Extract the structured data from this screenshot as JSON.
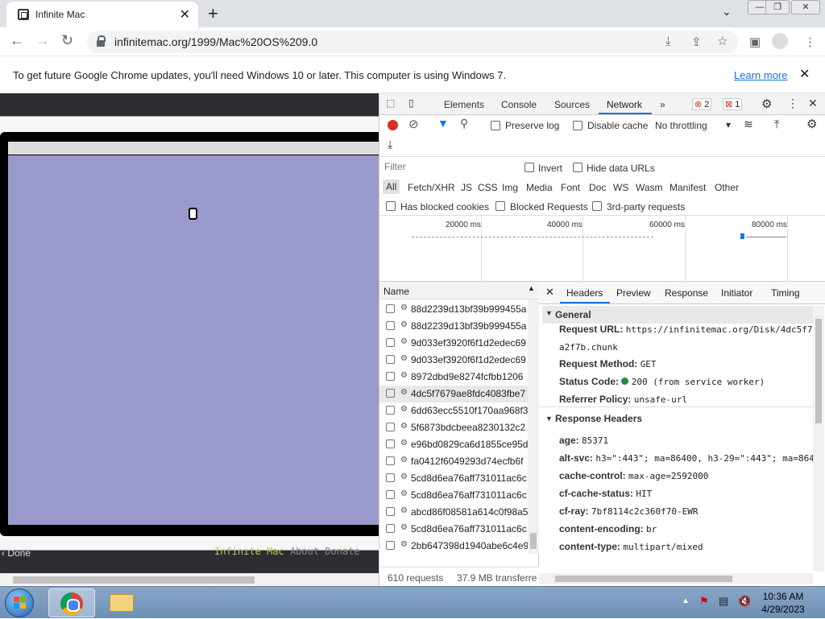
{
  "browser": {
    "tab_title": "Infinite Mac",
    "url": "infinitemac.org/1999/Mac%20OS%209.0"
  },
  "infobar": {
    "message": "To get future Google Chrome updates, you'll need Windows 10 or later. This computer is using Windows 7.",
    "link": "Learn more"
  },
  "page": {
    "status": "‹ Done",
    "footer_links": [
      "Infinite Mac",
      "About",
      "Donate"
    ]
  },
  "devtools": {
    "tabs": [
      "Elements",
      "Console",
      "Sources",
      "Network"
    ],
    "active_tab": "Network",
    "error_count": "2",
    "issue_count": "1",
    "toolbar": {
      "preserve_log": "Preserve log",
      "disable_cache": "Disable cache",
      "throttling": "No throttling"
    },
    "filter": {
      "placeholder": "Filter",
      "invert": "Invert",
      "hide_data_urls": "Hide data URLs",
      "types": [
        "All",
        "Fetch/XHR",
        "JS",
        "CSS",
        "Img",
        "Media",
        "Font",
        "Doc",
        "WS",
        "Wasm",
        "Manifest",
        "Other"
      ],
      "has_blocked_cookies": "Has blocked cookies",
      "blocked_requests": "Blocked Requests",
      "third_party": "3rd-party requests"
    },
    "timeline_ticks": [
      "20000 ms",
      "40000 ms",
      "60000 ms",
      "80000 ms"
    ],
    "requests": {
      "column": "Name",
      "rows": [
        "88d2239d13bf39b999455a",
        "88d2239d13bf39b999455a",
        "9d033ef3920f6f1d2edec69",
        "9d033ef3920f6f1d2edec69",
        "8972dbd9e8274fcfbb1206",
        "4dc5f7679ae8fdc4083fbe7",
        "6dd63ecc5510f170aa968f3",
        "5f6873bdcbeea8230132c2",
        "e96bd0829ca6d1855ce95d",
        "fa0412f6049293d74ecfb6f",
        "5cd8d6ea76aff731011ac6c",
        "5cd8d6ea76aff731011ac6c",
        "abcd86f08581a614c0f98a5",
        "5cd8d6ea76aff731011ac6c",
        "2bb647398d1940abe6c4e9"
      ],
      "selected_index": 5,
      "count": "610 requests",
      "transferred": "37.9 MB transferre"
    },
    "details": {
      "tabs": [
        "Headers",
        "Preview",
        "Response",
        "Initiator",
        "Timing"
      ],
      "active": "Headers",
      "general_title": "General",
      "general": [
        {
          "k": "Request URL:",
          "v": "https://infinitemac.org/Disk/4dc5f7"
        },
        {
          "k": "",
          "v": "a2f7b.chunk"
        },
        {
          "k": "Request Method:",
          "v": "GET"
        },
        {
          "k": "Status Code:",
          "v": "200  (from service worker)"
        },
        {
          "k": "Referrer Policy:",
          "v": "unsafe-url"
        }
      ],
      "response_title": "Response Headers",
      "response": [
        {
          "k": "age:",
          "v": "85371"
        },
        {
          "k": "alt-svc:",
          "v": "h3=\":443\"; ma=86400, h3-29=\":443\"; ma=864"
        },
        {
          "k": "cache-control:",
          "v": "max-age=2592000"
        },
        {
          "k": "cf-cache-status:",
          "v": "HIT"
        },
        {
          "k": "cf-ray:",
          "v": "7bf8114c2c360f70-EWR"
        },
        {
          "k": "content-encoding:",
          "v": "br"
        },
        {
          "k": "content-type:",
          "v": "multipart/mixed"
        }
      ],
      "status_color": "#1e8e3e"
    }
  },
  "taskbar": {
    "time": "10:36 AM",
    "date": "4/29/2023"
  }
}
